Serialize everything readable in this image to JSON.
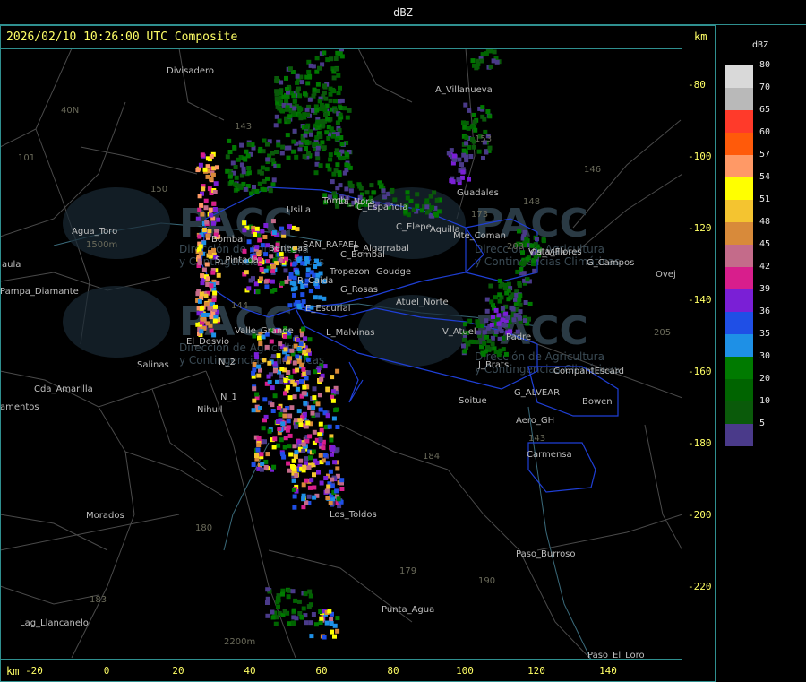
{
  "header": {
    "title": "dBZ"
  },
  "map": {
    "timestamp": "2026/02/10 10:26:00 UTC Composite",
    "km_label_top": "km",
    "km_label_bottom": "km",
    "x_ticks": [
      "-20",
      "0",
      "20",
      "40",
      "60",
      "80",
      "100",
      "120",
      "140"
    ],
    "y_ticks": [
      "-80",
      "-100",
      "-120",
      "-140",
      "-160",
      "-180",
      "-200",
      "-220"
    ],
    "place_names": [
      "Divisadero",
      "A_Villanueva",
      "Guadales",
      "Usilla",
      "Tombi",
      "La_Nora",
      "C_Española",
      "C_Elepe",
      "Aquilla",
      "Mte_Coman",
      "Cd_Villa",
      "Agua_Toro",
      "Pampa_Diamante",
      "aula",
      "S_Pintada",
      "Bombal",
      "Benegas",
      "SAN_RAFAEL",
      "E_Algarrabal",
      "C_Bombal",
      "Tropezon",
      "Goudge",
      "R_Caida",
      "G_Rosas",
      "E_Escurial",
      "Atuel_Norte",
      "Valle_Grande",
      "L_Malvinas",
      "V_Atuel",
      "Padre",
      "El_Desvio",
      "Salinas",
      "N_2",
      "N_1",
      "Nihuil",
      "Cda_Amarilla",
      "amentos",
      "J_Brats",
      "Soitue",
      "G_ALVEAR",
      "CompantEscard",
      "Bowen",
      "Aero_GH",
      "Carmensa",
      "Los_Toldos",
      "Morados",
      "Paso_Burroso",
      "Punta_Agua",
      "Lag_Llancanelo",
      "Paso_El_Loro",
      "G_Campos",
      "Ovej",
      "Vista_Flores"
    ],
    "route_numbers": [
      "143",
      "101",
      "40N",
      "150",
      "173",
      "144",
      "146",
      "148",
      "203",
      "184",
      "179",
      "180",
      "143",
      "190",
      "183",
      "205",
      "153"
    ],
    "watermark": {
      "brand": "PACC",
      "line1": "Dirección de Agricultura",
      "line2": "y Contingencias Climáticas"
    },
    "elevation_labels": [
      "1500m",
      "2200m"
    ]
  },
  "legend": {
    "unit": "dBZ",
    "items": [
      {
        "label": "80",
        "color": "#d9d9d9"
      },
      {
        "label": "70",
        "color": "#b9b9b9"
      },
      {
        "label": "65",
        "color": "#ff3a2a"
      },
      {
        "label": "60",
        "color": "#ff5a0a"
      },
      {
        "label": "57",
        "color": "#ff9966"
      },
      {
        "label": "54",
        "color": "#ffff00"
      },
      {
        "label": "51",
        "color": "#f4c430"
      },
      {
        "label": "48",
        "color": "#d88a3a"
      },
      {
        "label": "45",
        "color": "#c46b8a"
      },
      {
        "label": "42",
        "color": "#d81e8c"
      },
      {
        "label": "39",
        "color": "#7a1fd6"
      },
      {
        "label": "36",
        "color": "#1f4fe6"
      },
      {
        "label": "35",
        "color": "#1e90e6"
      },
      {
        "label": "30",
        "color": "#007a00"
      },
      {
        "label": "20",
        "color": "#006400"
      },
      {
        "label": "10",
        "color": "#0a5a0a"
      },
      {
        "label": "5",
        "color": "#4a3a8a"
      }
    ]
  }
}
